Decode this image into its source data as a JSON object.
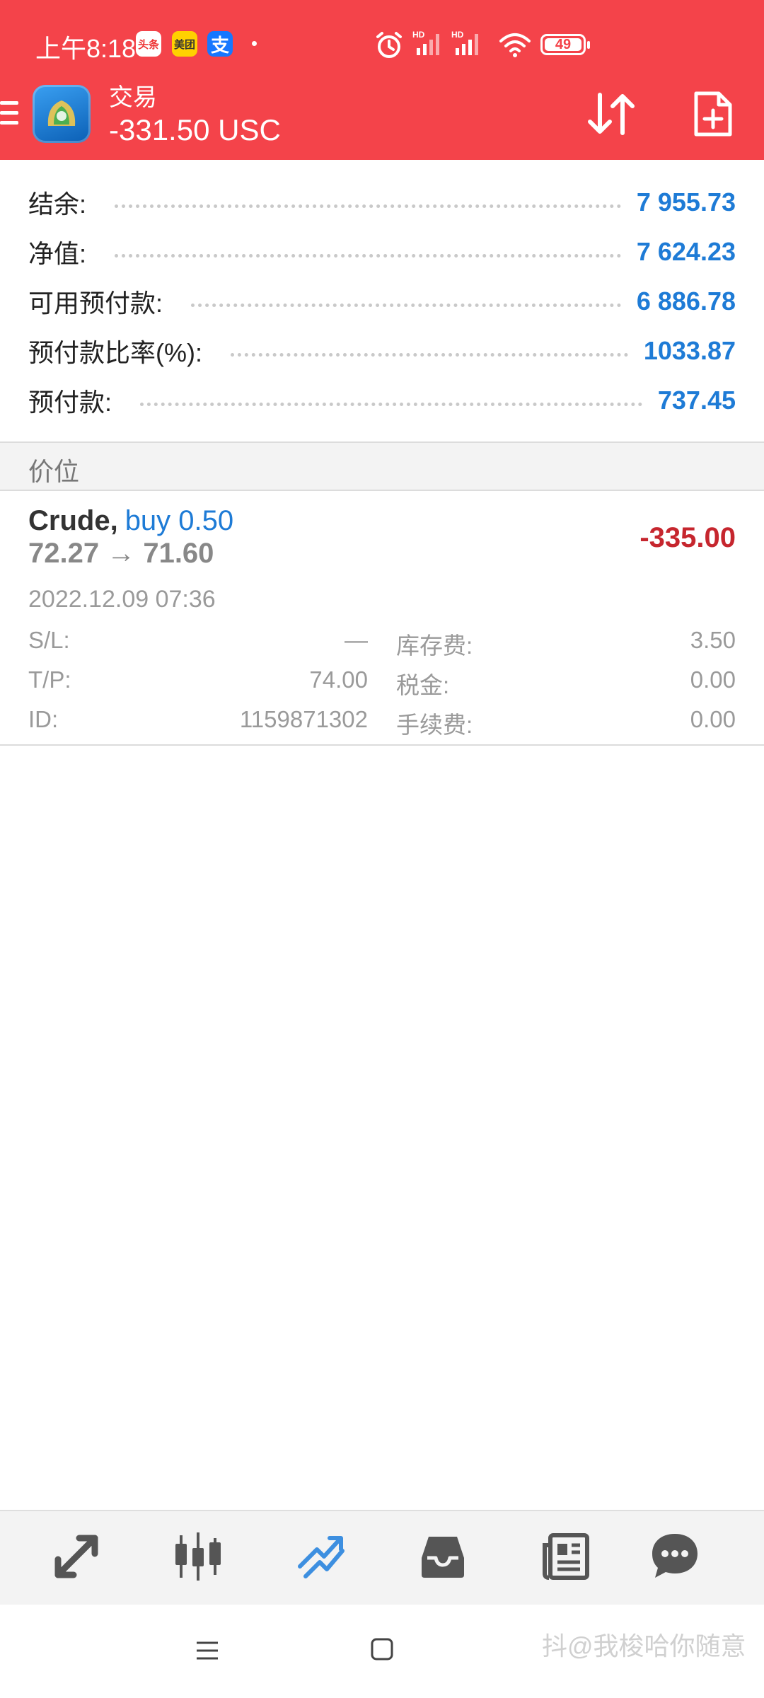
{
  "status_bar": {
    "time": "上午8:18",
    "notif_toutiao": "头条",
    "notif_meituan": "美团",
    "notif_alipay": "支",
    "battery": "49"
  },
  "header": {
    "title": "交易",
    "floating_pnl": "-331.50 USC",
    "menu_icon": "hamburger-menu-icon",
    "sort_icon": "sort-arrows-icon",
    "new_order_icon": "new-order-file-plus-icon"
  },
  "summary": {
    "rows": [
      {
        "label": "结余:",
        "value": "7 955.73"
      },
      {
        "label": "净值:",
        "value": "7 624.23"
      },
      {
        "label": "可用预付款:",
        "value": "6 886.78"
      },
      {
        "label": "预付款比率(%):",
        "value": "1033.87"
      },
      {
        "label": "预付款:",
        "value": "737.45"
      }
    ]
  },
  "section": {
    "title": "价位"
  },
  "position": {
    "symbol": "Crude,",
    "side": "buy 0.50",
    "prices": "72.27 → 71.60",
    "profit": "-335.00",
    "open_time": "2022.12.09 07:36",
    "sl_label": "S/L:",
    "sl_value": "—",
    "tp_label": "T/P:",
    "tp_value": "74.00",
    "id_label": "ID:",
    "id_value": "1159871302",
    "swap_label": "库存费:",
    "swap_value": "3.50",
    "tax_label": "税金:",
    "tax_value": "0.00",
    "commission_label": "手续费:",
    "commission_value": "0.00"
  },
  "bottom_nav": {
    "items": [
      "quotes-arrows-icon",
      "chart-candles-icon",
      "trade-trend-icon",
      "history-inbox-icon",
      "news-icon",
      "messages-chat-icon"
    ],
    "active": "trade-trend-icon",
    "active_color": "#3d8fe0",
    "inactive_color": "#555555"
  },
  "colors": {
    "header_bg": "#f4434a",
    "value_blue": "#1e7bd6",
    "loss_red": "#c6262e"
  },
  "watermark": "抖@我梭哈你随意"
}
